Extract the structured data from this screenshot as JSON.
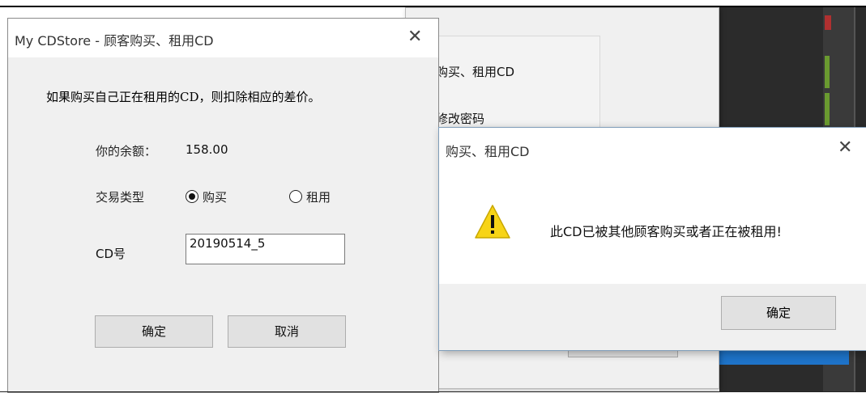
{
  "background_window": {
    "menu_items": [
      "购买、租用CD",
      "修改密码"
    ]
  },
  "main_dialog": {
    "title": "My CDStore - 顾客购买、租用CD",
    "close_glyph": "✕",
    "hint": "如果购买自己正在租用的CD，则扣除相应的差价。",
    "balance_label": "你的余额：",
    "balance_value": "158.00",
    "trade_type_label": "交易类型",
    "options": [
      {
        "label": "购买",
        "selected": true
      },
      {
        "label": "租用",
        "selected": false
      }
    ],
    "cd_label": "CD号",
    "cd_value": "20190514_5",
    "ok_label": "确定",
    "cancel_label": "取消"
  },
  "message_box": {
    "title": "购买、租用CD",
    "close_glyph": "✕",
    "icon": "warning-icon",
    "message": "此CD已被其他顾客购买或者正在被租用!",
    "ok_label": "确定"
  },
  "colors": {
    "dialog_bg": "#f0f0f0",
    "button_bg": "#e1e1e1",
    "warning_yellow": "#f7d417"
  }
}
